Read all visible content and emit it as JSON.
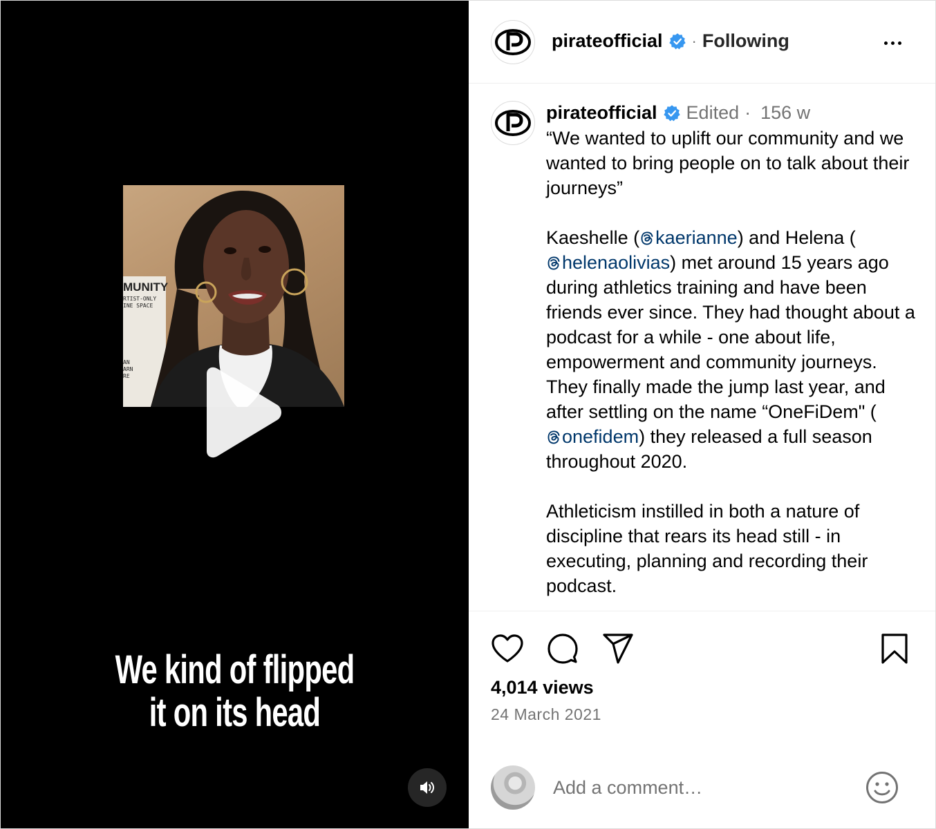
{
  "video": {
    "subtitle_line1": "We kind of flipped",
    "subtitle_line2": "it on its head",
    "poster_lines": [
      "MUNITY",
      "RTIST-ONLY",
      "INE SPACE",
      "AN",
      "ARN",
      "RE"
    ]
  },
  "header": {
    "username": "pirateofficial",
    "separator": "·",
    "follow_status": "Following"
  },
  "post": {
    "username": "pirateofficial",
    "edited": "Edited",
    "separator": "·",
    "age": "156 w",
    "quote": "“We wanted to uplift our community and we wanted to bring people on to talk about their journeys”",
    "p2_a": "Kaeshelle (",
    "mention_1": "kaerianne",
    "p2_b": ") and Helena (",
    "mention_2": "helenaolivias",
    "p2_c": ") met around 15 years ago during athletics training and have been friends ever since. They had thought about a podcast for a while - one about life, empowerment and community journeys. They finally made the jump last year, and after settling on the name “OneFiDem\" (",
    "mention_3": "onefidem",
    "p2_d": ") they released a full season throughout 2020.",
    "p3": "Athleticism instilled in both a nature of discipline that rears its head still - in executing, planning and recording their podcast."
  },
  "stats": {
    "views": "4,014 views",
    "date": "24 March 2021"
  },
  "comment": {
    "placeholder": "Add a comment…"
  },
  "colors": {
    "verified": "#3797f0",
    "mention": "#00376b",
    "secondary_text": "#737373"
  },
  "icons": [
    "play-icon",
    "volume-icon",
    "more-icon",
    "verified-icon",
    "threads-icon",
    "heart-icon",
    "comment-icon",
    "share-icon",
    "bookmark-icon",
    "emoji-icon"
  ]
}
